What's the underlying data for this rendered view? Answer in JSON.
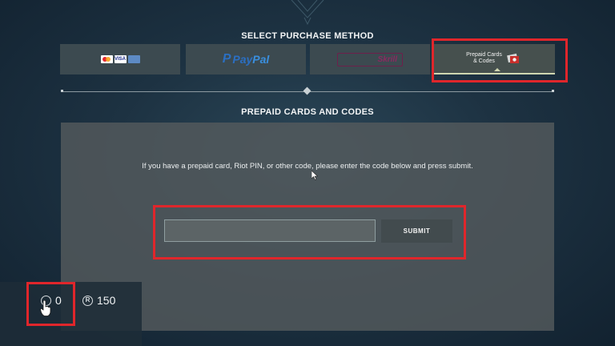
{
  "headings": {
    "purchase_method": "SELECT PURCHASE METHOD",
    "prepaid_section": "PREPAID CARDS AND CODES"
  },
  "payment_tabs": {
    "cards": {
      "logos": [
        "mastercard-icon",
        "visa-icon",
        "amex-icon"
      ],
      "visa_text": "VISA"
    },
    "paypal": {
      "p": "P",
      "word_pay": "Pay",
      "word_pal": "Pal"
    },
    "skrill": {
      "word": "Skrill"
    },
    "prepaid": {
      "label_line1": "Prepaid Cards",
      "label_line2": "& Codes",
      "selected": true
    }
  },
  "prepaid": {
    "instructions": "If you have a prepaid card, Riot PIN, or other code, please enter the code below and press submit.",
    "code_value": "",
    "submit_label": "SUBMIT"
  },
  "wallet": {
    "rp_icon": "radianite-icon",
    "rp_amount": "0",
    "vp_icon": "valorant-points-icon",
    "vp_symbol": "R",
    "vp_amount": "150"
  },
  "colors": {
    "highlight": "#e0262b",
    "panel": "#545a5d",
    "selected_underline": "#cfd6b0",
    "paypal_blue": "#2b6fc2"
  }
}
